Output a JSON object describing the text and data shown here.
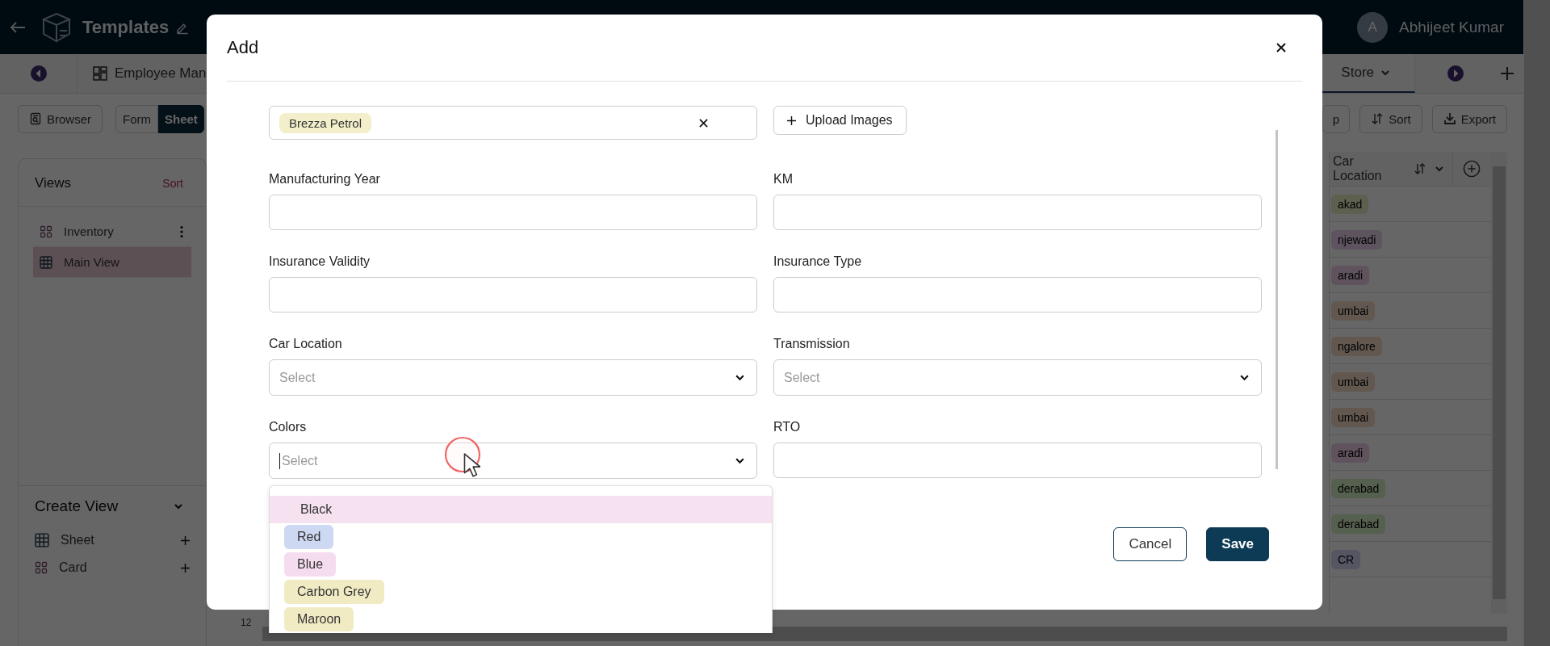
{
  "topbar": {
    "title": "Templates",
    "user": {
      "initial": "A",
      "name": "Abhijeet Kumar"
    }
  },
  "tabs": [
    {
      "label": "Employee Man",
      "selected": false
    },
    {
      "label": "Store",
      "selected": true
    }
  ],
  "toolbar": {
    "left": [
      {
        "label": "Browser",
        "kind": "icon",
        "selected": false
      },
      {
        "label": "Form",
        "kind": "plain",
        "selected": false
      },
      {
        "label": "Sheet",
        "kind": "plain",
        "selected": true
      }
    ],
    "right": [
      {
        "label": "p",
        "kind": "plain"
      },
      {
        "label": "Sort",
        "kind": "sort"
      },
      {
        "label": "Export",
        "kind": "export"
      }
    ]
  },
  "sidebar": {
    "title": "Views",
    "sort": "Sort",
    "views": [
      {
        "label": "Inventory",
        "kind": "card",
        "selected": false
      },
      {
        "label": "Main View",
        "kind": "sheet",
        "selected": true
      }
    ],
    "create": {
      "title": "Create View",
      "items": [
        {
          "label": "Sheet",
          "kind": "sheet"
        },
        {
          "label": "Card",
          "kind": "card"
        }
      ]
    }
  },
  "table": {
    "column": "Car Location",
    "rows": [
      {
        "value": "akad",
        "color": "#5d604e"
      },
      {
        "value": "njewadi",
        "color": "#5e5460"
      },
      {
        "value": "aradi",
        "color": "#60535e"
      },
      {
        "value": "umbai",
        "color": "#625850"
      },
      {
        "value": "ngalore",
        "color": "#625850"
      },
      {
        "value": "umbai",
        "color": "#625850"
      },
      {
        "value": "umbai",
        "color": "#625850"
      },
      {
        "value": "aradi",
        "color": "#60535e"
      },
      {
        "value": "derabad",
        "color": "#55604e"
      },
      {
        "value": "derabad",
        "color": "#55604e"
      },
      {
        "value": "CR",
        "color": "#565662"
      }
    ],
    "row_number": "12"
  },
  "modal": {
    "title": "Add",
    "top_row": {
      "chip": {
        "label": "Brezza Petrol",
        "color": "#f3efcb"
      },
      "upload": "Upload Images"
    },
    "fields": [
      {
        "label": "Manufacturing Year",
        "kind": "text"
      },
      {
        "label": "KM",
        "kind": "text"
      },
      {
        "label": "Insurance Validity",
        "kind": "text"
      },
      {
        "label": "Insurance Type",
        "kind": "text"
      },
      {
        "label": "Car Location",
        "kind": "select",
        "placeholder": "Select",
        "open": false
      },
      {
        "label": "Transmission",
        "kind": "select",
        "placeholder": "Select",
        "open": false
      },
      {
        "label": "Colors",
        "kind": "select",
        "placeholder": "Select",
        "open": true,
        "options": [
          {
            "label": "Black",
            "color": "#f6e1f1",
            "highlighted": true
          },
          {
            "label": "Red",
            "color": "#cdd9f2",
            "highlighted": false
          },
          {
            "label": "Blue",
            "color": "#f6dcef",
            "highlighted": false
          },
          {
            "label": "Carbon Grey",
            "color": "#f1ebc4",
            "highlighted": false
          },
          {
            "label": "Maroon",
            "color": "#f1ebc4",
            "highlighted": false
          }
        ]
      },
      {
        "label": "RTO",
        "kind": "text"
      }
    ],
    "buttons": [
      {
        "label": "Cancel",
        "kind": "secondary"
      },
      {
        "label": "Save",
        "kind": "primary"
      }
    ]
  }
}
